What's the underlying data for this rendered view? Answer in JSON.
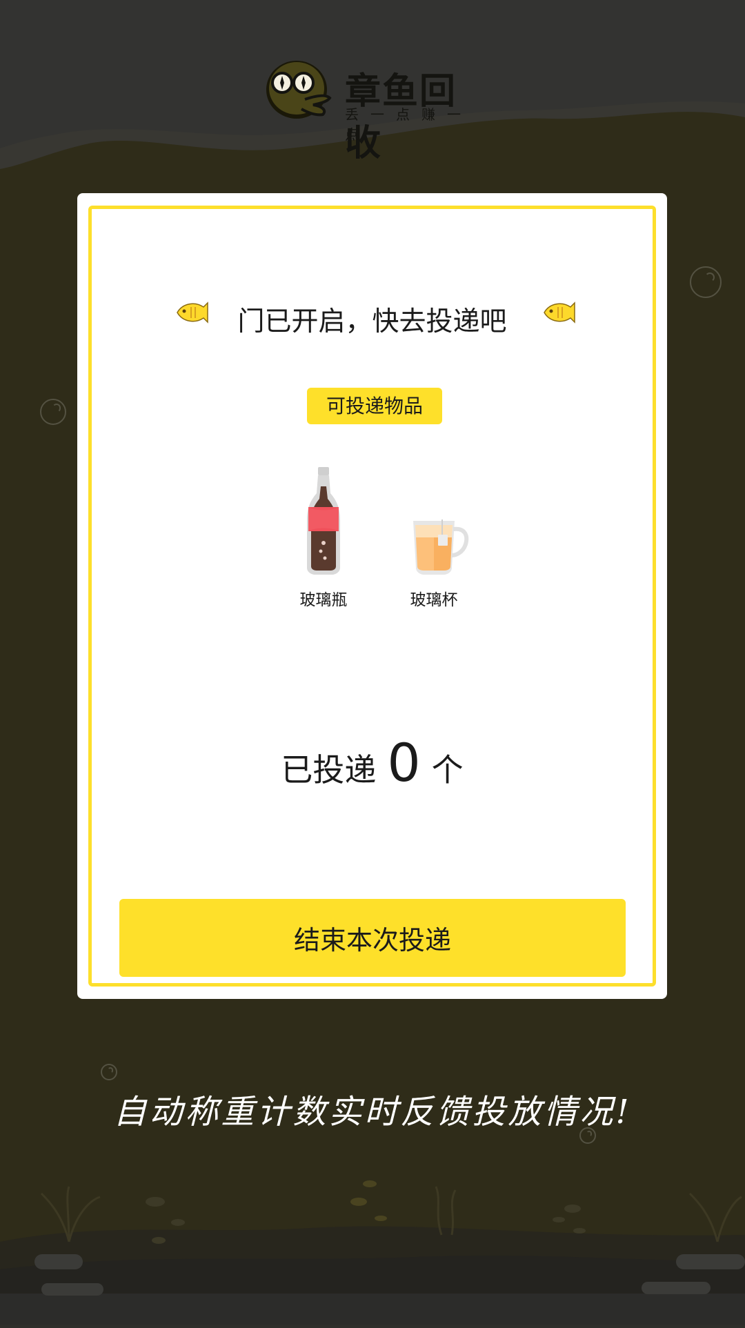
{
  "logo": {
    "title": "章鱼回收",
    "subtitle": "丢一点赚一点"
  },
  "card": {
    "headline": "门已开启，快去投递吧",
    "badge": "可投递物品",
    "items": [
      {
        "label": "玻璃瓶",
        "icon": "glass-bottle-icon"
      },
      {
        "label": "玻璃杯",
        "icon": "glass-cup-icon"
      }
    ],
    "count": {
      "prefix": "已投递",
      "value": "0",
      "unit": "个"
    },
    "end_button": "结束本次投递"
  },
  "slogan": "自动称重计数实时反馈投放情况!",
  "colors": {
    "accent": "#fee02a",
    "background_dark": "#2f2c19",
    "overlay": "#323230"
  }
}
